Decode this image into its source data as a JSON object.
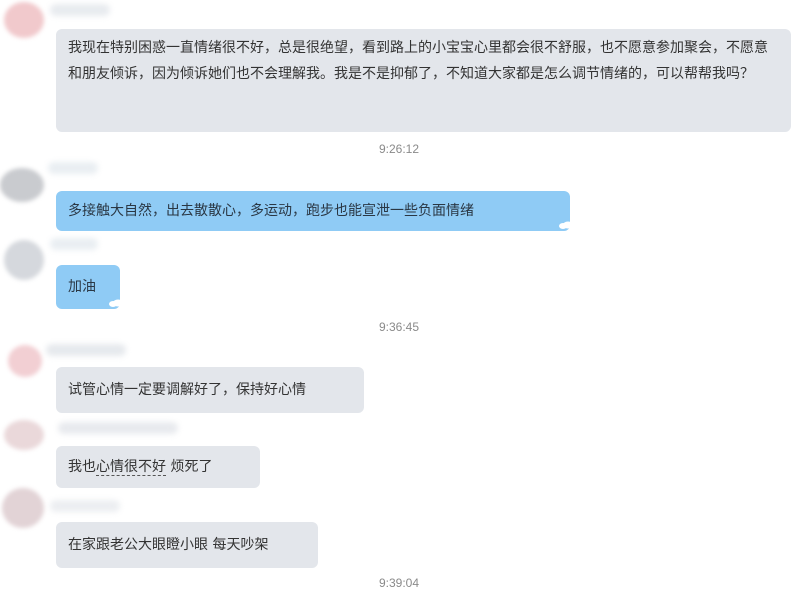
{
  "messages": [
    {
      "text": "我现在特别困惑一直情绪很不好，总是很绝望，看到路上的小宝宝心里都会很不舒服，也不愿意参加聚会，不愿意和朋友倾诉，因为倾诉她们也不会理解我。我是不是抑郁了，不知道大家都是怎么调节情绪的，可以帮帮我吗？"
    },
    {
      "text": "多接触大自然，出去散散心，多运动，跑步也能宣泄一些负面情绪"
    },
    {
      "text": "加油"
    },
    {
      "text": "试管心情一定要调解好了，保持好心情"
    },
    {
      "text_before": "我也",
      "text_underlined": "心情很不好",
      "text_after": " 烦死了"
    },
    {
      "text": "在家跟老公大眼瞪小眼 每天吵架"
    }
  ],
  "timestamps": [
    "9:26:12",
    "9:36:45",
    "9:39:04"
  ],
  "colors": {
    "gray_bubble": "#e3e6eb",
    "blue_bubble": "#8fcbf5",
    "timestamp": "#8a8a8a",
    "text": "#333333"
  }
}
